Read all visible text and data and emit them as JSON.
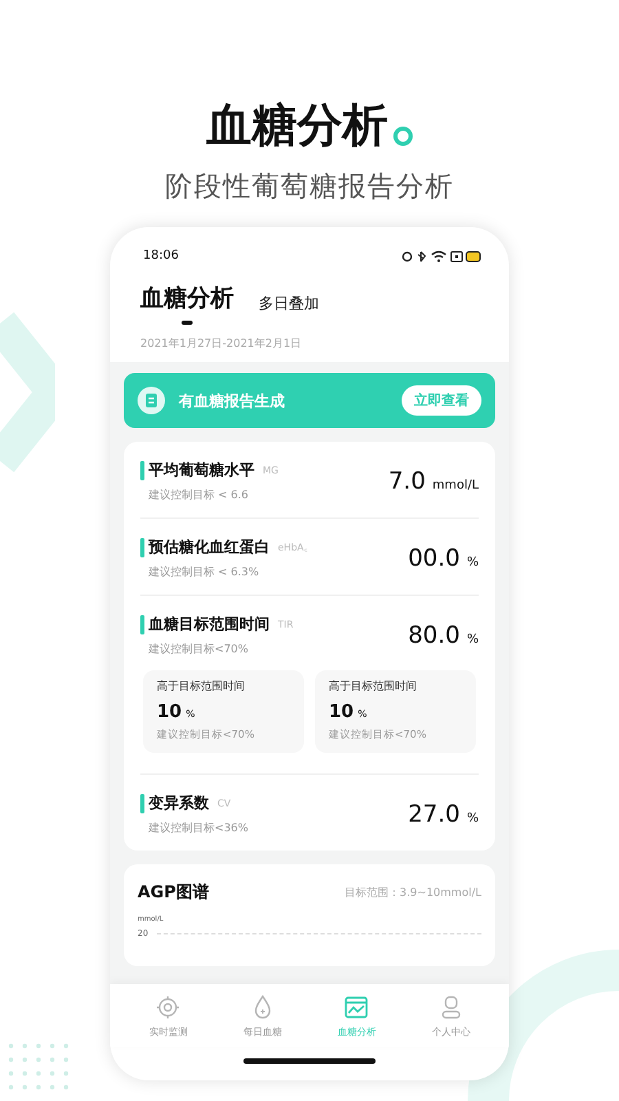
{
  "promo": {
    "title": "血糖分析",
    "subtitle": "阶段性葡萄糖报告分析"
  },
  "status_bar": {
    "time": "18:06"
  },
  "tabs": [
    {
      "label": "血糖分析",
      "selected": true
    },
    {
      "label": "多日叠加",
      "selected": false
    }
  ],
  "date_range": "2021年1月27日-2021年2月1日",
  "banner": {
    "text": "有血糖报告生成",
    "button": "立即查看"
  },
  "metrics": [
    {
      "title": "平均葡萄糖水平",
      "abbr": "MG",
      "target": "建议控制目标 < 6.6",
      "value": "7.0",
      "unit": "mmol/L"
    },
    {
      "title": "预估糖化血红蛋白",
      "abbr": "eHbA꜀",
      "target": "建议控制目标 < 6.3%",
      "value": "00.0",
      "unit": "%"
    },
    {
      "title": "血糖目标范围时间",
      "abbr": "TIR",
      "target": "建议控制目标<70%",
      "value": "80.0",
      "unit": "%",
      "sub_stats": [
        {
          "title": "高于目标范围时间",
          "value": "10",
          "unit": "%",
          "target": "建议控制目标<70%"
        },
        {
          "title": "高于目标范围时间",
          "value": "10",
          "unit": "%",
          "target": "建议控制目标<70%"
        }
      ]
    },
    {
      "title": "变异系数",
      "abbr": "CV",
      "target": "建议控制目标<36%",
      "value": "27.0",
      "unit": "%"
    }
  ],
  "agp": {
    "title": "AGP图谱",
    "target_range": "目标范围：3.9~10mmol/L",
    "y_unit": "mmol/L",
    "y_tick": "20"
  },
  "nav": [
    {
      "label": "实时监测",
      "selected": false
    },
    {
      "label": "每日血糖",
      "selected": false
    },
    {
      "label": "血糖分析",
      "selected": true
    },
    {
      "label": "个人中心",
      "selected": false
    }
  ]
}
